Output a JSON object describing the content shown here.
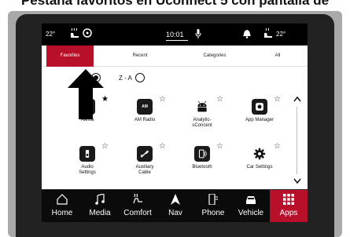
{
  "caption": "Pestaña favoritos en Uconnect 5 con pantalla de",
  "status_bar": {
    "temp_left": "22°",
    "clock": "10:01",
    "temp_right": "22°"
  },
  "tabs": [
    {
      "label": "Favorites",
      "active": true
    },
    {
      "label": "Recent"
    },
    {
      "label": "Categories"
    },
    {
      "label": "All"
    }
  ],
  "sort": {
    "za_label": "Z - A"
  },
  "apps": [
    {
      "label": "Alexia",
      "icon": "alexa-icon",
      "star": "★"
    },
    {
      "label": "AM Radio",
      "icon": "am-radio-icon",
      "icon_text": "AM",
      "star": "☆"
    },
    {
      "label": "Analytic-sConcent",
      "label_line1": "Analytic-",
      "label_line2": "sConcent",
      "icon": "android-icon",
      "star": "☆"
    },
    {
      "label": "App Manager",
      "icon": "app-manager-icon",
      "star": "☆"
    },
    {
      "label": "Audio Settings",
      "label_line1": "Audio",
      "label_line2": "Settings",
      "icon": "audio-settings-icon",
      "star": "☆"
    },
    {
      "label": "Auxiliary Cable",
      "label_line1": "Auxiliary",
      "label_line2": "Cable",
      "icon": "aux-cable-icon",
      "star": "☆"
    },
    {
      "label": "Bluetooth",
      "icon": "bluetooth-icon",
      "star": "☆"
    },
    {
      "label": "Car Settings",
      "icon": "car-settings-icon",
      "star": "☆"
    }
  ],
  "bottom_nav": [
    {
      "label": "Home",
      "icon": "home-icon"
    },
    {
      "label": "Media",
      "icon": "music-note-icon"
    },
    {
      "label": "Comfort",
      "icon": "comfort-icon"
    },
    {
      "label": "Nav",
      "icon": "nav-arrow-icon"
    },
    {
      "label": "Phone",
      "icon": "phone-icon"
    },
    {
      "label": "Vehicle",
      "icon": "vehicle-icon"
    },
    {
      "label": "Apps",
      "icon": "apps-grid-icon",
      "active": true
    }
  ],
  "colors": {
    "accent": "#b8102b",
    "status_bar": "#000000",
    "nav_bar": "#0b0b0b"
  }
}
